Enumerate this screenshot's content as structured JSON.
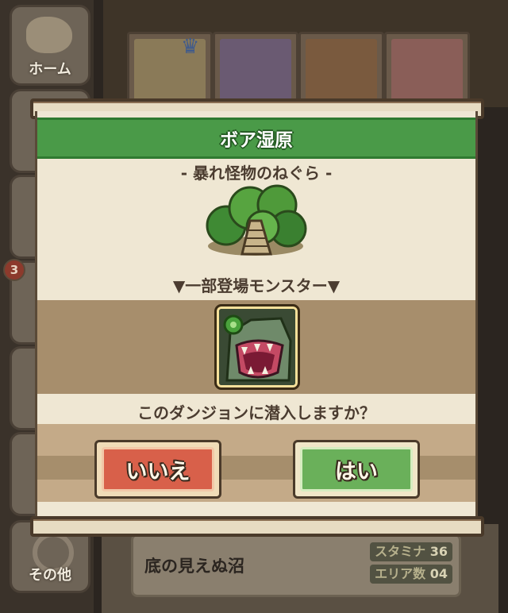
{
  "sidebar": {
    "home_label": "ホーム",
    "other_label": "その他",
    "badge_count": "3"
  },
  "dungeon_row": {
    "name": "底の見えぬ沼",
    "stamina_label": "スタミナ",
    "stamina_value": "36",
    "area_label": "エリア数",
    "area_value": "04"
  },
  "dialog": {
    "title": "ボア湿原",
    "subtitle": "- 暴れ怪物のねぐら -",
    "monsters_label": "▼一部登場モンスター▼",
    "question": "このダンジョンに潜入しますか？",
    "no_label": "いいえ",
    "yes_label": "はい"
  },
  "colors": {
    "title_band": "#4a9a48",
    "no_button": "#d8604a",
    "yes_button": "#6ab05a",
    "panel": "#efe7d3"
  },
  "icons": [
    "crown-icon",
    "forest-icon",
    "dragon-monster-icon",
    "gear-icon"
  ]
}
